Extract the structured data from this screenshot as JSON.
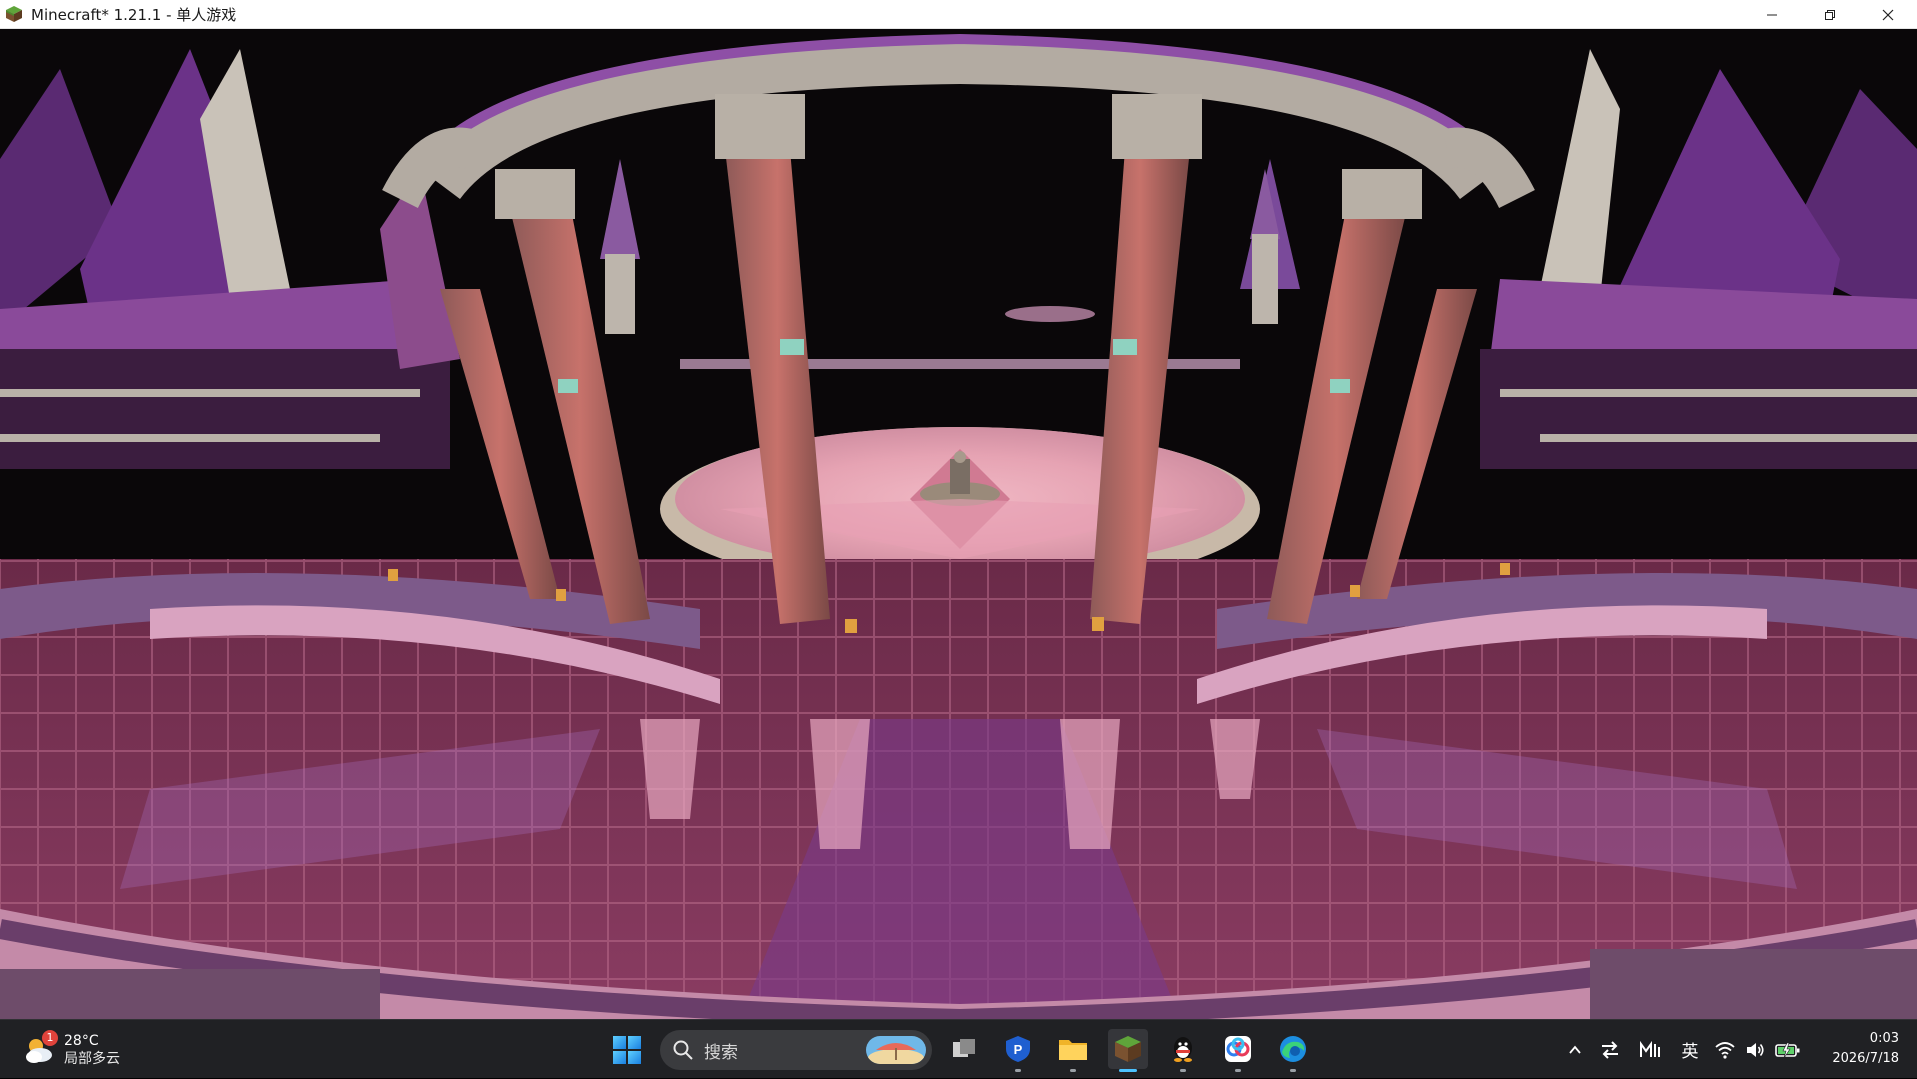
{
  "window": {
    "title": "Minecraft* 1.21.1 - 单人游戏",
    "app_icon": "grass-block-icon",
    "controls": [
      "minimize-icon",
      "restore-icon",
      "close-icon"
    ]
  },
  "game": {
    "scene": "pink-purple castle plaza with glass floor",
    "colors": {
      "sky": "#0a0709",
      "floor_glass": "#7a3a5a",
      "pink_stone": "#d7a0ad",
      "purple_accent": "#7b3fa0",
      "pillar": "#b8655e"
    }
  },
  "taskbar": {
    "weather": {
      "temperature": "28°C",
      "condition": "局部多云",
      "badge": "1"
    },
    "search": {
      "placeholder": "搜索"
    },
    "apps": [
      {
        "name": "task-view-icon",
        "active": false
      },
      {
        "name": "password-manager-icon",
        "active": false
      },
      {
        "name": "file-explorer-icon",
        "active": false
      },
      {
        "name": "minecraft-icon",
        "active": true
      },
      {
        "name": "qq-icon",
        "active": false
      },
      {
        "name": "netdisk-icon",
        "active": false
      },
      {
        "name": "edge-browser-icon",
        "active": false
      }
    ],
    "tray": {
      "ime": "英",
      "icons": [
        "chevron-up-icon",
        "swap-icon",
        "ime-mode-icon",
        "wifi-icon",
        "volume-icon",
        "battery-icon"
      ]
    },
    "clock": {
      "time": "0:03",
      "date": "2026/7/18"
    },
    "accent": "#4cc2ff"
  }
}
